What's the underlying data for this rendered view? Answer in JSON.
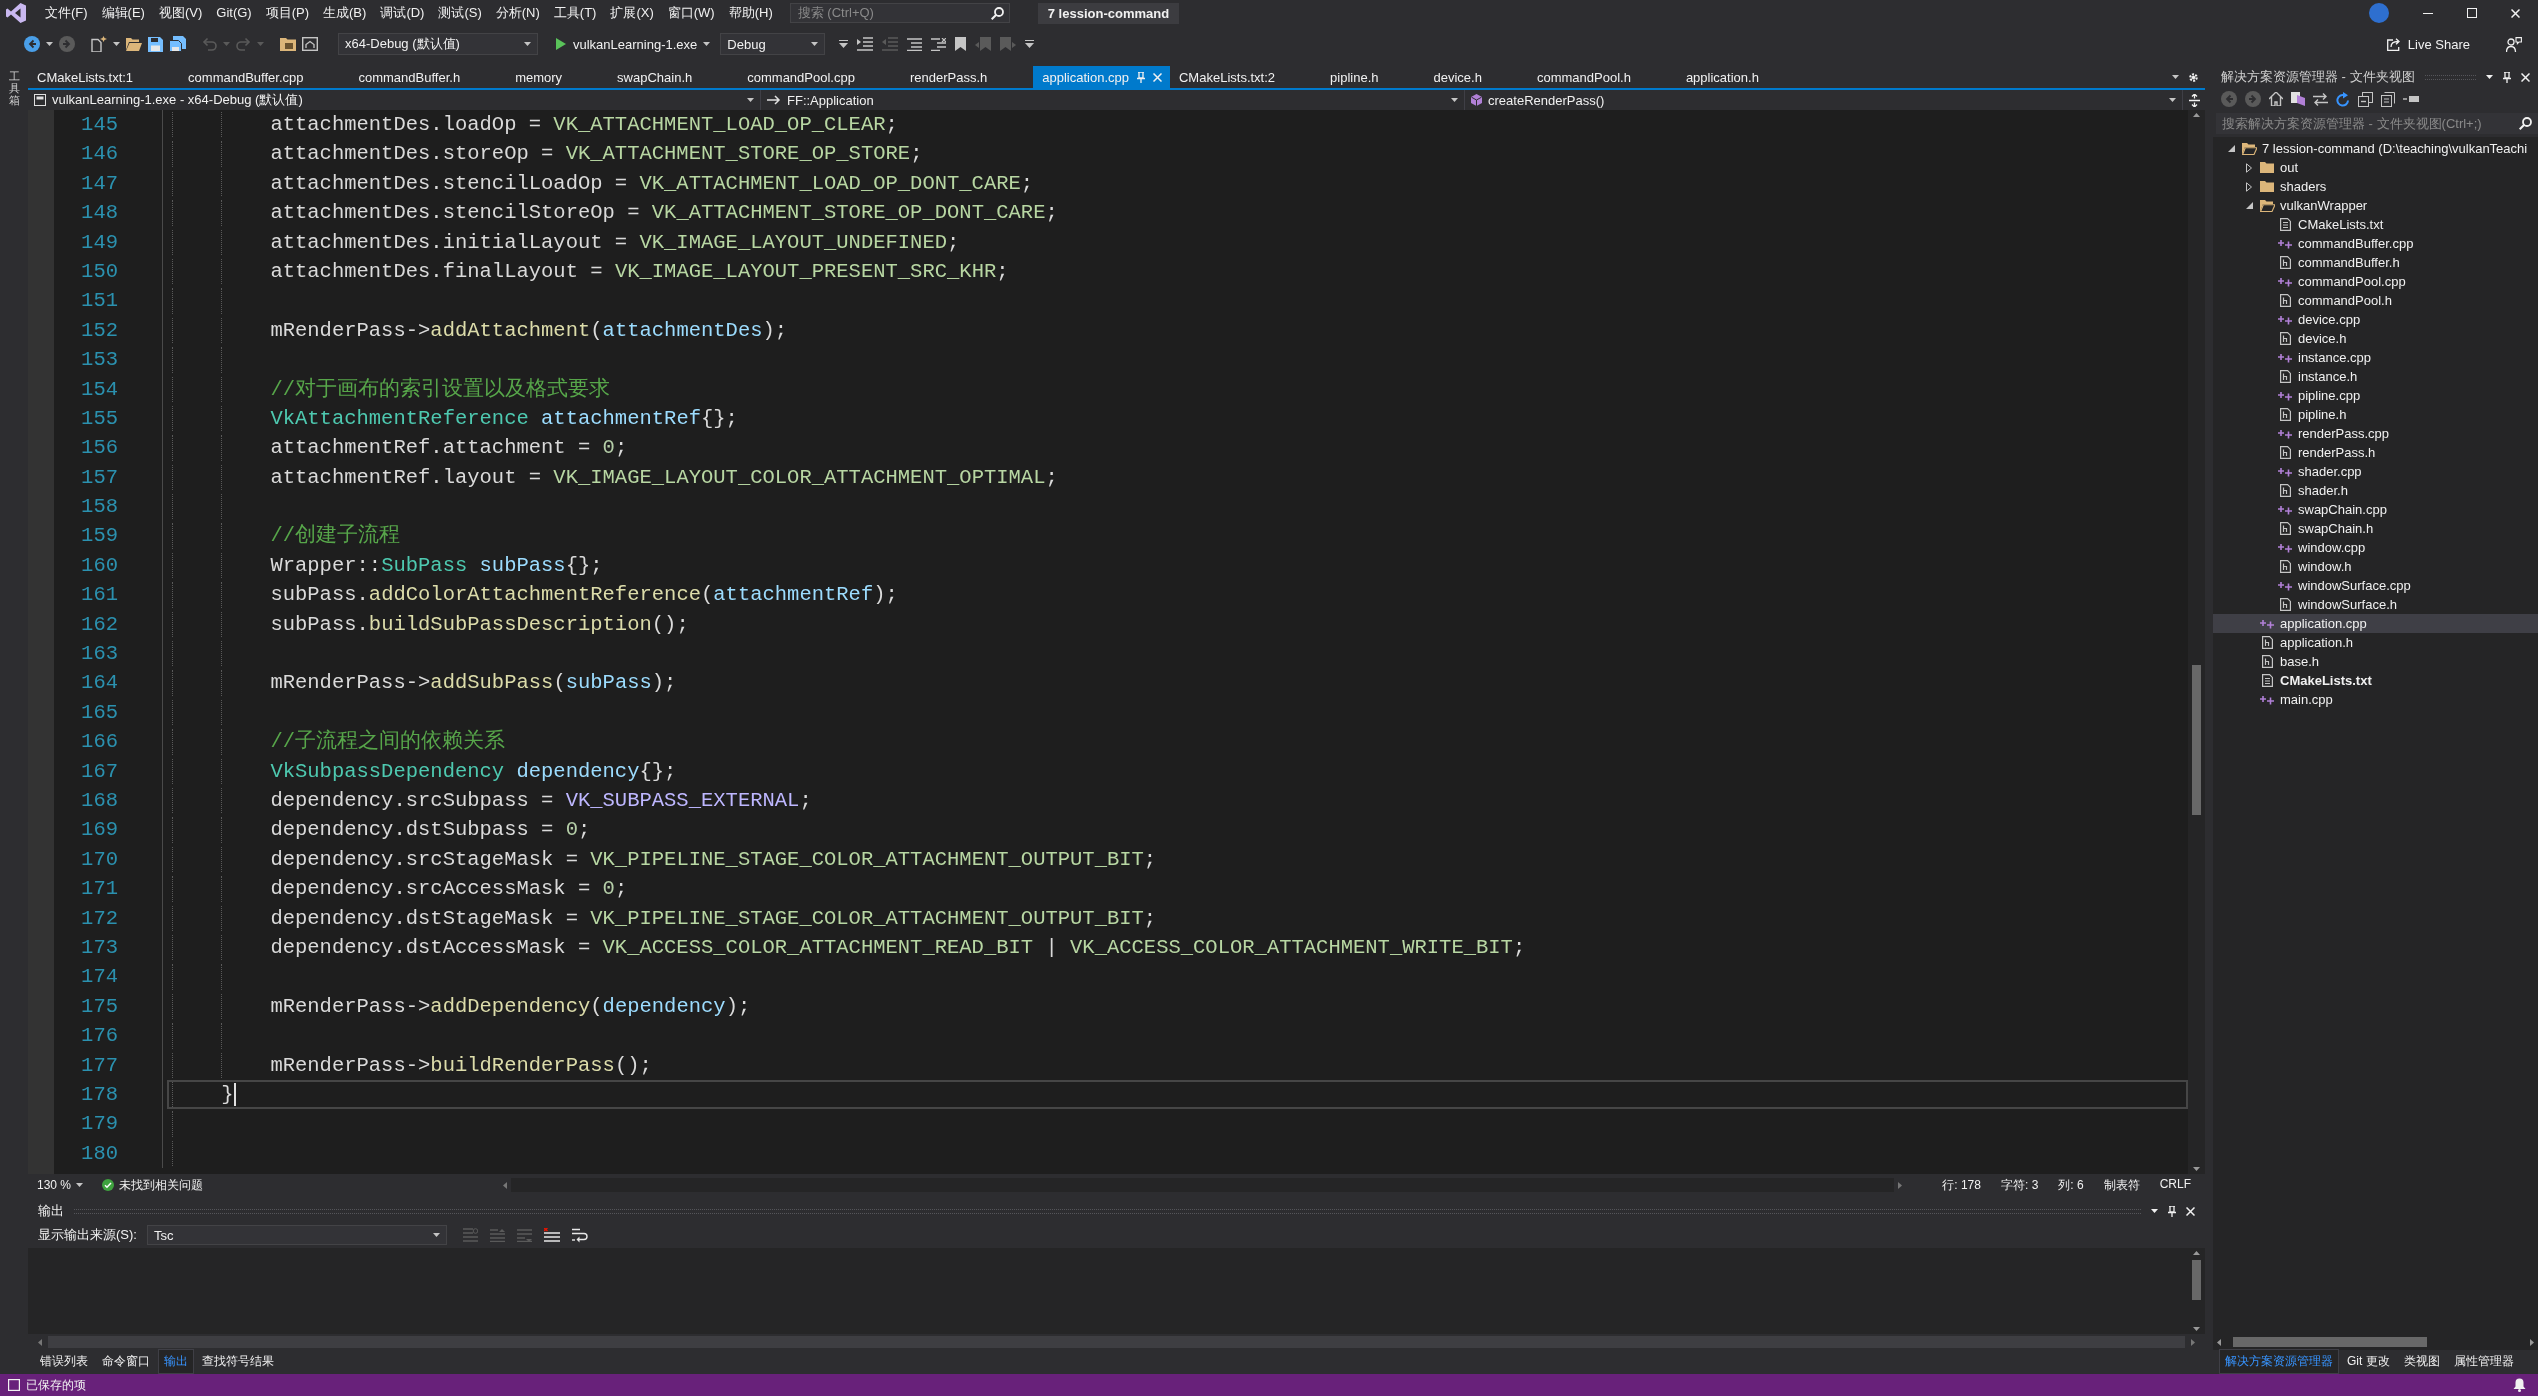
{
  "title_bar": {
    "menus": [
      "文件(F)",
      "编辑(E)",
      "视图(V)",
      "Git(G)",
      "项目(P)",
      "生成(B)",
      "调试(D)",
      "测试(S)",
      "分析(N)",
      "工具(T)",
      "扩展(X)",
      "窗口(W)",
      "帮助(H)"
    ],
    "search": {
      "placeholder": "搜索 (Ctrl+Q)"
    },
    "title": "7 lession-command"
  },
  "toolbar": {
    "buttons": [
      {
        "kind": "back",
        "disabled": false,
        "menu": true
      },
      {
        "kind": "forward",
        "disabled": true,
        "menu": false
      },
      {
        "kind": "new_item",
        "disabled": false,
        "menu": true
      },
      {
        "kind": "open",
        "disabled": false,
        "menu": false
      },
      {
        "kind": "save",
        "disabled": false,
        "menu": false
      },
      {
        "kind": "save_all",
        "disabled": false,
        "menu": false
      },
      {
        "kind": "undo",
        "disabled": true,
        "menu": true
      },
      {
        "kind": "redo",
        "disabled": true,
        "menu": true
      },
      {
        "kind": "solution",
        "disabled": false,
        "menu": false
      },
      {
        "kind": "browse",
        "disabled": false,
        "menu": false
      }
    ],
    "configuration": "x64-Debug (默认值)",
    "run_target": "vulkanLearning-1.exe",
    "build_config": "Debug",
    "tools": [
      {
        "kind": "options",
        "disabled": false
      },
      {
        "kind": "indent",
        "disabled": false
      },
      {
        "kind": "outdent",
        "disabled": true
      },
      {
        "kind": "comment",
        "disabled": false
      },
      {
        "kind": "uncomment",
        "disabled": false
      },
      {
        "kind": "bookmark",
        "disabled": false
      },
      {
        "kind": "bookmark_prev",
        "disabled": true
      },
      {
        "kind": "bookmark_next",
        "disabled": true
      },
      {
        "kind": "options",
        "disabled": false
      }
    ],
    "live_share": "Live Share"
  },
  "toolbox": {
    "label": "工具箱"
  },
  "editor": {
    "tabs": [
      {
        "label": "CMakeLists.txt:1",
        "selected": false
      },
      {
        "label": "commandBuffer.cpp",
        "selected": false
      },
      {
        "label": "commandBuffer.h",
        "selected": false
      },
      {
        "label": "memory",
        "selected": false
      },
      {
        "label": "swapChain.h",
        "selected": false
      },
      {
        "label": "commandPool.cpp",
        "selected": false
      },
      {
        "label": "renderPass.h",
        "selected": false
      },
      {
        "label": "application.cpp",
        "selected": true
      },
      {
        "label": "CMakeLists.txt:2",
        "selected": false
      },
      {
        "label": "pipline.h",
        "selected": false
      },
      {
        "label": "device.h",
        "selected": false
      },
      {
        "label": "commandPool.h",
        "selected": false
      },
      {
        "label": "application.h",
        "selected": false
      }
    ],
    "nav": {
      "project": "vulkanLearning-1.exe - x64-Debug (默认值)",
      "scope": "FF::Application",
      "member": "createRenderPass()"
    },
    "lines": [
      {
        "kind": "block",
        "children": [
          {
            "kind": "block",
            "children": [
              {
                "kind": "line",
                "number": "145",
                "current": false,
                "tokens": [
                  {
                    "kind": "plain",
                    "text": "attachmentDes.loadOp = "
                  },
                  {
                    "kind": "enum",
                    "text": "VK_ATTACHMENT_LOAD_OP_CLEAR"
                  },
                  {
                    "kind": "plain",
                    "text": ";"
                  }
                ]
              },
              {
                "kind": "line",
                "number": "146",
                "current": false,
                "tokens": [
                  {
                    "kind": "plain",
                    "text": "attachmentDes.storeOp = "
                  },
                  {
                    "kind": "enum",
                    "text": "VK_ATTACHMENT_STORE_OP_STORE"
                  },
                  {
                    "kind": "plain",
                    "text": ";"
                  }
                ]
              },
              {
                "kind": "line",
                "number": "147",
                "current": false,
                "tokens": [
                  {
                    "kind": "plain",
                    "text": "attachmentDes.stencilLoadOp = "
                  },
                  {
                    "kind": "enum",
                    "text": "VK_ATTACHMENT_LOAD_OP_DONT_CARE"
                  },
                  {
                    "kind": "plain",
                    "text": ";"
                  }
                ]
              },
              {
                "kind": "line",
                "number": "148",
                "current": false,
                "tokens": [
                  {
                    "kind": "plain",
                    "text": "attachmentDes.stencilStoreOp = "
                  },
                  {
                    "kind": "enum",
                    "text": "VK_ATTACHMENT_STORE_OP_DONT_CARE"
                  },
                  {
                    "kind": "plain",
                    "text": ";"
                  }
                ]
              },
              {
                "kind": "line",
                "number": "149",
                "current": false,
                "tokens": [
                  {
                    "kind": "plain",
                    "text": "attachmentDes.initialLayout = "
                  },
                  {
                    "kind": "enum",
                    "text": "VK_IMAGE_LAYOUT_UNDEFINED"
                  },
                  {
                    "kind": "plain",
                    "text": ";"
                  }
                ]
              },
              {
                "kind": "line",
                "number": "150",
                "current": false,
                "tokens": [
                  {
                    "kind": "plain",
                    "text": "attachmentDes.finalLayout = "
                  },
                  {
                    "kind": "enum",
                    "text": "VK_IMAGE_LAYOUT_PRESENT_SRC_KHR"
                  },
                  {
                    "kind": "plain",
                    "text": ";"
                  }
                ]
              },
              {
                "kind": "line",
                "number": "151",
                "current": false
              },
              {
                "kind": "line",
                "number": "152",
                "current": false,
                "tokens": [
                  {
                    "kind": "plain",
                    "text": "mRenderPass->"
                  },
                  {
                    "kind": "function",
                    "text": "addAttachment"
                  },
                  {
                    "kind": "plain",
                    "text": "("
                  },
                  {
                    "kind": "arg",
                    "text": "attachmentDes"
                  },
                  {
                    "kind": "plain",
                    "text": ");"
                  }
                ]
              },
              {
                "kind": "line",
                "number": "153",
                "current": false
              },
              {
                "kind": "line",
                "number": "154",
                "current": false,
                "tokens": [
                  {
                    "kind": "comment",
                    "text": "//对于画布的索引设置以及格式要求"
                  }
                ]
              },
              {
                "kind": "line",
                "number": "155",
                "current": false,
                "tokens": [
                  {
                    "kind": "type",
                    "text": "VkAttachmentReference "
                  },
                  {
                    "kind": "arg",
                    "text": "attachmentRef"
                  },
                  {
                    "kind": "plain",
                    "text": "{};"
                  }
                ]
              },
              {
                "kind": "line",
                "number": "156",
                "current": false,
                "tokens": [
                  {
                    "kind": "plain",
                    "text": "attachmentRef.attachment = "
                  },
                  {
                    "kind": "number",
                    "text": "0"
                  },
                  {
                    "kind": "plain",
                    "text": ";"
                  }
                ]
              },
              {
                "kind": "line",
                "number": "157",
                "current": false,
                "tokens": [
                  {
                    "kind": "plain",
                    "text": "attachmentRef.layout = "
                  },
                  {
                    "kind": "enum",
                    "text": "VK_IMAGE_LAYOUT_COLOR_ATTACHMENT_OPTIMAL"
                  },
                  {
                    "kind": "plain",
                    "text": ";"
                  }
                ]
              },
              {
                "kind": "line",
                "number": "158",
                "current": false
              },
              {
                "kind": "line",
                "number": "159",
                "current": false,
                "tokens": [
                  {
                    "kind": "comment",
                    "text": "//创建子流程"
                  }
                ]
              },
              {
                "kind": "line",
                "number": "160",
                "current": false,
                "tokens": [
                  {
                    "kind": "plain",
                    "text": "Wrapper::"
                  },
                  {
                    "kind": "type",
                    "text": "SubPass "
                  },
                  {
                    "kind": "arg",
                    "text": "subPass"
                  },
                  {
                    "kind": "plain",
                    "text": "{};"
                  }
                ]
              },
              {
                "kind": "line",
                "number": "161",
                "current": false,
                "tokens": [
                  {
                    "kind": "plain",
                    "text": "subPass."
                  },
                  {
                    "kind": "function",
                    "text": "addColorAttachmentReference"
                  },
                  {
                    "kind": "plain",
                    "text": "("
                  },
                  {
                    "kind": "arg",
                    "text": "attachmentRef"
                  },
                  {
                    "kind": "plain",
                    "text": ");"
                  }
                ]
              },
              {
                "kind": "line",
                "number": "162",
                "current": false,
                "tokens": [
                  {
                    "kind": "plain",
                    "text": "subPass."
                  },
                  {
                    "kind": "function",
                    "text": "buildSubPassDescription"
                  },
                  {
                    "kind": "plain",
                    "text": "();"
                  }
                ]
              },
              {
                "kind": "line",
                "number": "163",
                "current": false
              },
              {
                "kind": "line",
                "number": "164",
                "current": false,
                "tokens": [
                  {
                    "kind": "plain",
                    "text": "mRenderPass->"
                  },
                  {
                    "kind": "function",
                    "text": "addSubPass"
                  },
                  {
                    "kind": "plain",
                    "text": "("
                  },
                  {
                    "kind": "arg",
                    "text": "subPass"
                  },
                  {
                    "kind": "plain",
                    "text": ");"
                  }
                ]
              },
              {
                "kind": "line",
                "number": "165",
                "current": false
              },
              {
                "kind": "line",
                "number": "166",
                "current": false,
                "tokens": [
                  {
                    "kind": "comment",
                    "text": "//子流程之间的依赖关系"
                  }
                ]
              },
              {
                "kind": "line",
                "number": "167",
                "current": false,
                "tokens": [
                  {
                    "kind": "type",
                    "text": "VkSubpassDependency "
                  },
                  {
                    "kind": "arg",
                    "text": "dependency"
                  },
                  {
                    "kind": "plain",
                    "text": "{};"
                  }
                ]
              },
              {
                "kind": "line",
                "number": "168",
                "current": false,
                "tokens": [
                  {
                    "kind": "plain",
                    "text": "dependency.srcSubpass = "
                  },
                  {
                    "kind": "macro",
                    "text": "VK_SUBPASS_EXTERNAL"
                  },
                  {
                    "kind": "plain",
                    "text": ";"
                  }
                ]
              },
              {
                "kind": "line",
                "number": "169",
                "current": false,
                "tokens": [
                  {
                    "kind": "plain",
                    "text": "dependency.dstSubpass = "
                  },
                  {
                    "kind": "number",
                    "text": "0"
                  },
                  {
                    "kind": "plain",
                    "text": ";"
                  }
                ]
              },
              {
                "kind": "line",
                "number": "170",
                "current": false,
                "tokens": [
                  {
                    "kind": "plain",
                    "text": "dependency.srcStageMask = "
                  },
                  {
                    "kind": "enum",
                    "text": "VK_PIPELINE_STAGE_COLOR_ATTACHMENT_OUTPUT_BIT"
                  },
                  {
                    "kind": "plain",
                    "text": ";"
                  }
                ]
              },
              {
                "kind": "line",
                "number": "171",
                "current": false,
                "tokens": [
                  {
                    "kind": "plain",
                    "text": "dependency.srcAccessMask = "
                  },
                  {
                    "kind": "number",
                    "text": "0"
                  },
                  {
                    "kind": "plain",
                    "text": ";"
                  }
                ]
              },
              {
                "kind": "line",
                "number": "172",
                "current": false,
                "tokens": [
                  {
                    "kind": "plain",
                    "text": "dependency.dstStageMask = "
                  },
                  {
                    "kind": "enum",
                    "text": "VK_PIPELINE_STAGE_COLOR_ATTACHMENT_OUTPUT_BIT"
                  },
                  {
                    "kind": "plain",
                    "text": ";"
                  }
                ]
              },
              {
                "kind": "line",
                "number": "173",
                "current": false,
                "tokens": [
                  {
                    "kind": "plain",
                    "text": "dependency.dstAccessMask = "
                  },
                  {
                    "kind": "enum",
                    "text": "VK_ACCESS_COLOR_ATTACHMENT_READ_BIT"
                  },
                  {
                    "kind": "plain",
                    "text": " | "
                  },
                  {
                    "kind": "enum",
                    "text": "VK_ACCESS_COLOR_ATTACHMENT_WRITE_BIT"
                  },
                  {
                    "kind": "plain",
                    "text": ";"
                  }
                ]
              },
              {
                "kind": "line",
                "number": "174",
                "current": false
              },
              {
                "kind": "line",
                "number": "175",
                "current": false,
                "tokens": [
                  {
                    "kind": "plain",
                    "text": "mRenderPass->"
                  },
                  {
                    "kind": "function",
                    "text": "addDependency"
                  },
                  {
                    "kind": "plain",
                    "text": "("
                  },
                  {
                    "kind": "arg",
                    "text": "dependency"
                  },
                  {
                    "kind": "plain",
                    "text": ");"
                  }
                ]
              },
              {
                "kind": "line",
                "number": "176",
                "current": false
              },
              {
                "kind": "line",
                "number": "177",
                "current": false,
                "tokens": [
                  {
                    "kind": "plain",
                    "text": "mRenderPass->"
                  },
                  {
                    "kind": "function",
                    "text": "buildRenderPass"
                  },
                  {
                    "kind": "plain",
                    "text": "();"
                  }
                ]
              }
            ]
          },
          {
            "kind": "line",
            "number": "178",
            "current": true,
            "tokens": [
              {
                "kind": "plain",
                "text": "}"
              }
            ]
          },
          {
            "kind": "line",
            "number": "179",
            "current": false
          },
          {
            "kind": "line",
            "number": "180",
            "current": false
          }
        ]
      }
    ],
    "zoom": "130 %",
    "issues": "未找到相关问题",
    "position": [
      "行: 178",
      "字符: 3",
      "列: 6",
      "制表符",
      "CRLF"
    ]
  },
  "output": {
    "title": "输出",
    "source_label": "显示输出来源(S):",
    "source": "Tsc",
    "tools": [
      {
        "kind": "find_message",
        "disabled": true
      },
      {
        "kind": "prev_message",
        "disabled": true
      },
      {
        "kind": "next_message",
        "disabled": true
      },
      {
        "kind": "clear_all",
        "disabled": false
      },
      {
        "kind": "word_wrap",
        "disabled": false
      }
    ],
    "tabs": [
      {
        "label": "错误列表",
        "selected": false
      },
      {
        "label": "命令窗口",
        "selected": false
      },
      {
        "label": "输出",
        "selected": true
      },
      {
        "label": "查找符号结果",
        "selected": false
      }
    ]
  },
  "solution_explorer": {
    "title": "解决方案资源管理器 - 文件夹视图",
    "tools": [
      {
        "kind": "back",
        "disabled": true
      },
      {
        "kind": "forward",
        "disabled": true
      },
      {
        "kind": "home",
        "disabled": false
      },
      {
        "kind": "switch_views",
        "disabled": false
      },
      {
        "kind": "sync",
        "disabled": false
      },
      {
        "kind": "refresh",
        "disabled": false
      },
      {
        "kind": "collapse",
        "disabled": false
      },
      {
        "kind": "show_all",
        "disabled": false
      },
      {
        "kind": "preview",
        "disabled": false
      }
    ],
    "search": {
      "placeholder": "搜索解决方案资源管理器 - 文件夹视图(Ctrl+;)"
    },
    "tree": [
      {
        "label": "7 lession-command (D:\\teaching\\vulkanTeachi",
        "kind": "folder",
        "expanded": true,
        "selected": false,
        "children": [
          {
            "label": "out",
            "kind": "folder",
            "expanded": false,
            "selected": false
          },
          {
            "label": "shaders",
            "kind": "folder",
            "expanded": false,
            "selected": false
          },
          {
            "label": "vulkanWrapper",
            "kind": "folder",
            "expanded": true,
            "selected": false,
            "children": [
              {
                "label": "CMakeLists.txt",
                "kind": "text",
                "selected": false,
                "startup": false
              },
              {
                "label": "commandBuffer.cpp",
                "kind": "source",
                "selected": false,
                "startup": false
              },
              {
                "label": "commandBuffer.h",
                "kind": "header",
                "selected": false,
                "startup": false
              },
              {
                "label": "commandPool.cpp",
                "kind": "source",
                "selected": false,
                "startup": false
              },
              {
                "label": "commandPool.h",
                "kind": "header",
                "selected": false,
                "startup": false
              },
              {
                "label": "device.cpp",
                "kind": "source",
                "selected": false,
                "startup": false
              },
              {
                "label": "device.h",
                "kind": "header",
                "selected": false,
                "startup": false
              },
              {
                "label": "instance.cpp",
                "kind": "source",
                "selected": false,
                "startup": false
              },
              {
                "label": "instance.h",
                "kind": "header",
                "selected": false,
                "startup": false
              },
              {
                "label": "pipline.cpp",
                "kind": "source",
                "selected": false,
                "startup": false
              },
              {
                "label": "pipline.h",
                "kind": "header",
                "selected": false,
                "startup": false
              },
              {
                "label": "renderPass.cpp",
                "kind": "source",
                "selected": false,
                "startup": false
              },
              {
                "label": "renderPass.h",
                "kind": "header",
                "selected": false,
                "startup": false
              },
              {
                "label": "shader.cpp",
                "kind": "source",
                "selected": false,
                "startup": false
              },
              {
                "label": "shader.h",
                "kind": "header",
                "selected": false,
                "startup": false
              },
              {
                "label": "swapChain.cpp",
                "kind": "source",
                "selected": false,
                "startup": false
              },
              {
                "label": "swapChain.h",
                "kind": "header",
                "selected": false,
                "startup": false
              },
              {
                "label": "window.cpp",
                "kind": "source",
                "selected": false,
                "startup": false
              },
              {
                "label": "window.h",
                "kind": "header",
                "selected": false,
                "startup": false
              },
              {
                "label": "windowSurface.cpp",
                "kind": "source",
                "selected": false,
                "startup": false
              },
              {
                "label": "windowSurface.h",
                "kind": "header",
                "selected": false,
                "startup": false
              }
            ]
          },
          {
            "label": "application.cpp",
            "kind": "source",
            "selected": true,
            "startup": false
          },
          {
            "label": "application.h",
            "kind": "header",
            "selected": false,
            "startup": false
          },
          {
            "label": "base.h",
            "kind": "header",
            "selected": false,
            "startup": false
          },
          {
            "label": "CMakeLists.txt",
            "kind": "text",
            "selected": false,
            "startup": true
          },
          {
            "label": "main.cpp",
            "kind": "source",
            "selected": false,
            "startup": false
          }
        ]
      }
    ],
    "tabs": [
      {
        "label": "解决方案资源管理器",
        "selected": true
      },
      {
        "label": "Git 更改",
        "selected": false
      },
      {
        "label": "类视图",
        "selected": false
      },
      {
        "label": "属性管理器",
        "selected": false
      }
    ]
  },
  "status_bar": {
    "message": "已保存的项"
  }
}
